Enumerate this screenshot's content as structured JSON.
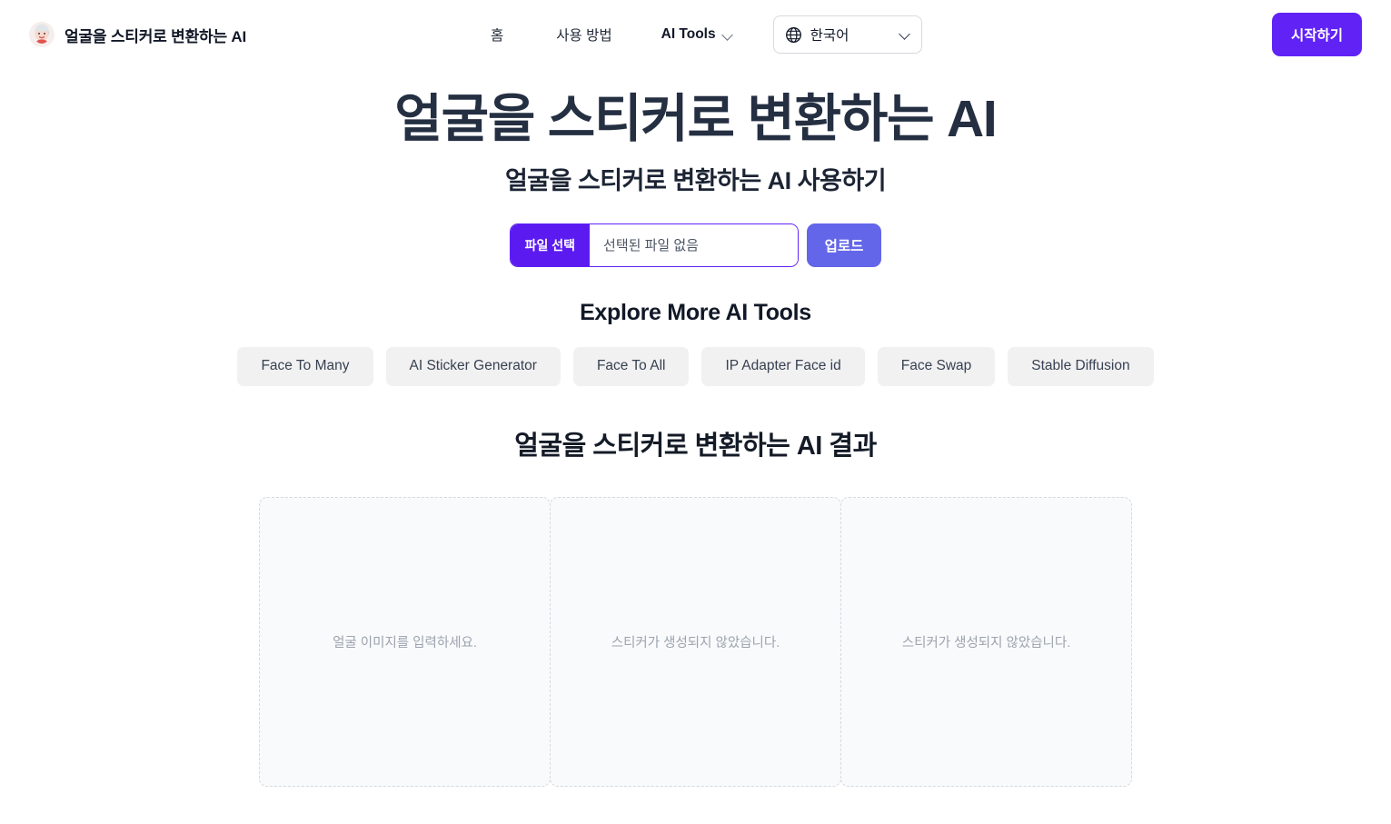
{
  "header": {
    "logo_icon": "face-sticker-logo",
    "brand_title": "얼굴을 스티커로 변환하는 AI",
    "nav": {
      "home": "홈",
      "howto": "사용 방법",
      "ai_tools": "AI Tools",
      "ai_tools_chevron_icon": "chevron-down-icon"
    },
    "language": {
      "globe_icon": "globe-icon",
      "selected": "한국어",
      "chevron_icon": "chevron-down-icon"
    },
    "cta_label": "시작하기"
  },
  "hero": {
    "title": "얼굴을 스티커로 변환하는 AI",
    "subtitle": "얼굴을 스티커로 변환하는 AI 사용하기"
  },
  "upload": {
    "choose_label": "파일 선택",
    "file_name": "선택된 파일 없음",
    "upload_label": "업로드"
  },
  "explore": {
    "title": "Explore More AI Tools",
    "chips": [
      "Face To Many",
      "AI Sticker Generator",
      "Face To All",
      "IP Adapter Face id",
      "Face Swap",
      "Stable Diffusion"
    ]
  },
  "results": {
    "title": "얼굴을 스티커로 변환하는 AI 결과",
    "boxes": [
      {
        "placeholder": "얼굴 이미지를 입력하세요."
      },
      {
        "placeholder": "스티커가 생성되지 않았습니다."
      },
      {
        "placeholder": "스티커가 생성되지 않았습니다."
      }
    ]
  },
  "colors": {
    "brand_purple": "#6022f5",
    "file_choose_purple": "#5b1bf0",
    "upload_indigo": "#6366e8",
    "heading_navy": "#252f42",
    "chip_bg": "#f1f1f2",
    "placeholder_gray": "#9ca3af",
    "dashed_border": "#d5d9de"
  }
}
